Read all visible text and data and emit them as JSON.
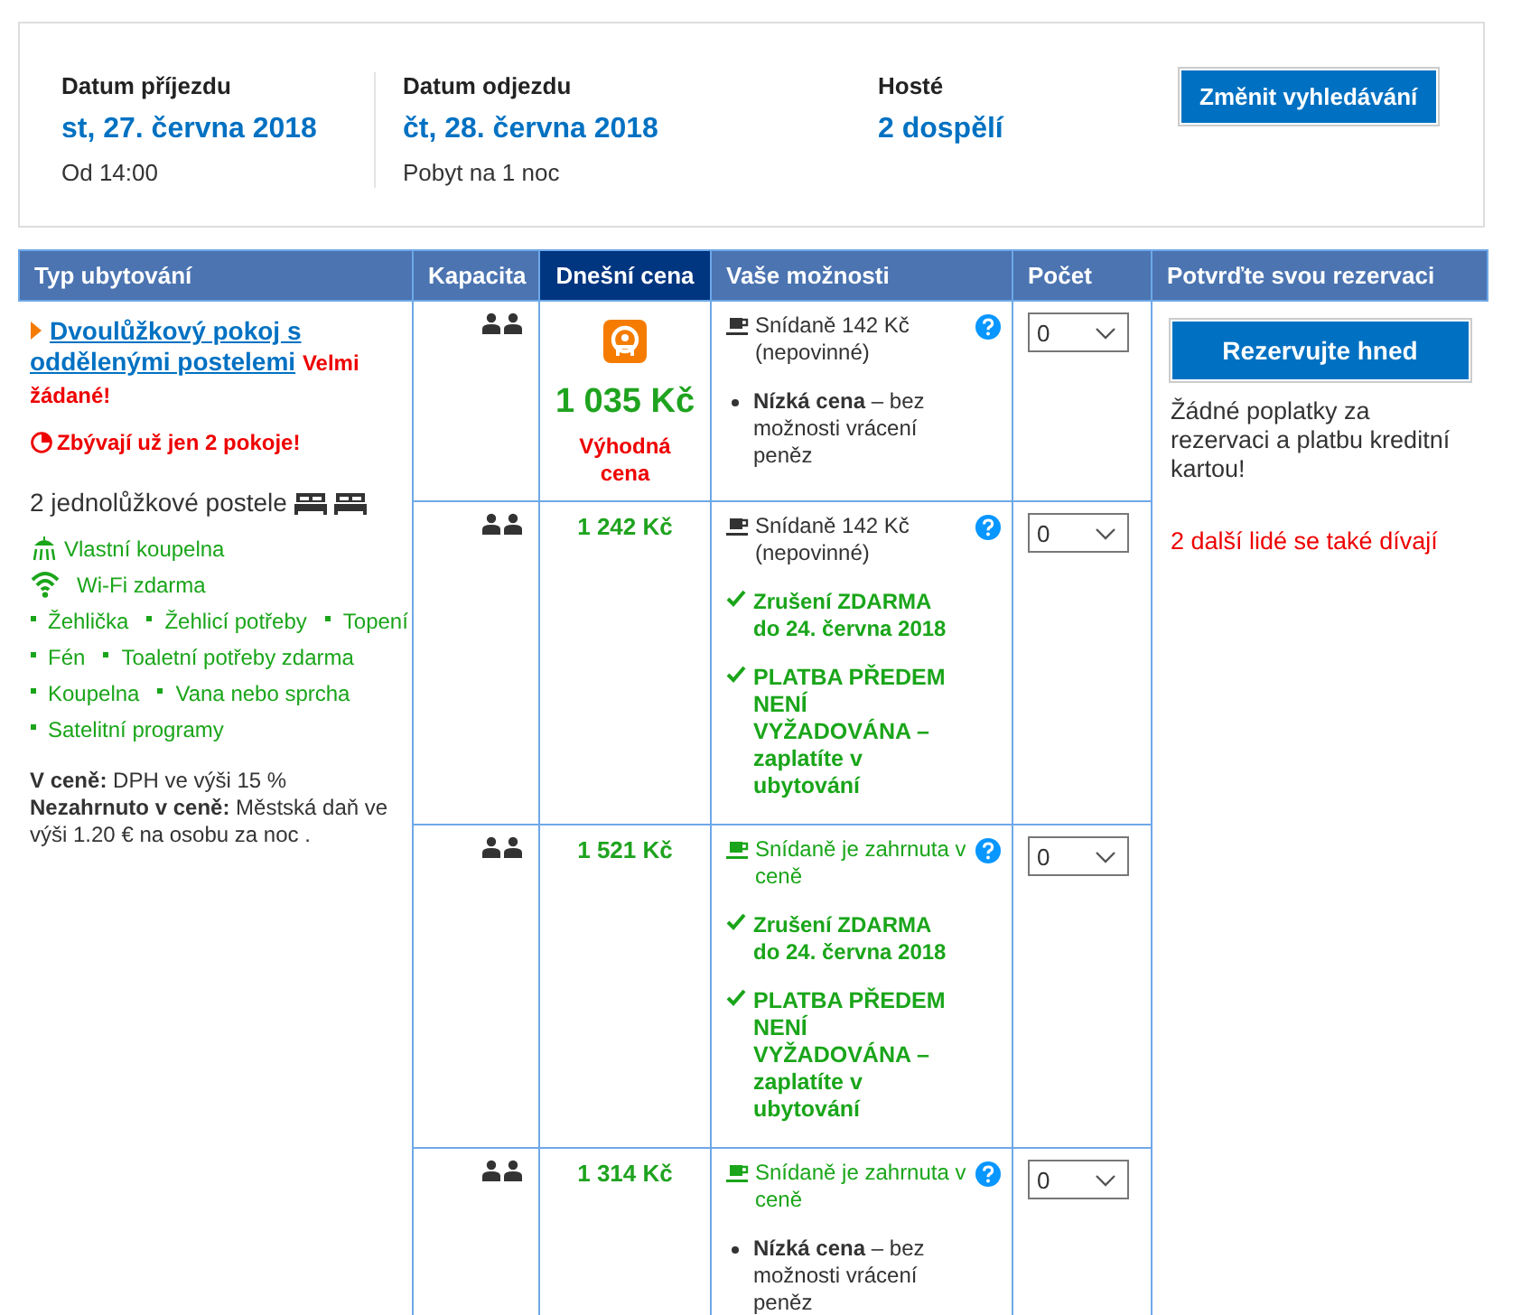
{
  "search": {
    "fields": [
      {
        "label": "Datum příjezdu",
        "value": "st, 27. června 2018",
        "note": "Od 14:00"
      },
      {
        "label": "Datum odjezdu",
        "value": "čt, 28. června 2018",
        "note": "Pobyt na 1 noc"
      },
      {
        "label": "Hosté",
        "value": "2 dospělí"
      }
    ],
    "button": "Změnit vyhledávání"
  },
  "table": {
    "columns": [
      {
        "label": "Typ ubytování",
        "selected": false
      },
      {
        "label": "Kapacita",
        "selected": false
      },
      {
        "label": "Dnešní cena",
        "selected": true
      },
      {
        "label": "Vaše možnosti",
        "selected": false
      },
      {
        "label": "Počet",
        "selected": false
      },
      {
        "label": "Potvrďte svou rezervaci",
        "selected": false
      }
    ],
    "room": {
      "name": "Dvoulůžkový pokoj s oddělenými postelemi",
      "badge": "Velmi žádané!",
      "scarcity": "Zbývají už jen 2 pokoje!",
      "beds": "2 jednolůžkové postele",
      "facilities": [
        {
          "kind": "shower",
          "label": "Vlastní koupelna"
        },
        {
          "kind": "wifi",
          "label": "Wi-Fi zdarma"
        },
        {
          "kind": "bullets",
          "items": [
            "Žehlička",
            "Žehlicí potřeby",
            "Topení"
          ]
        },
        {
          "kind": "bullets",
          "items": [
            "Fén",
            "Toaletní potřeby zdarma"
          ]
        },
        {
          "kind": "bullets",
          "items": [
            "Koupelna",
            "Vana nebo sprcha"
          ]
        },
        {
          "kind": "bullets",
          "items": [
            "Satelitní programy"
          ]
        }
      ],
      "notes": [
        "**V ceně:** DPH ve výši 15 %",
        "**Nezahrnuto v ceně:** Městská daň ve výši 1.20 € na osobu za noc ."
      ]
    },
    "offers": [
      {
        "deal": true,
        "price": "1 035 Kč",
        "deal_label": "Výhodná cena",
        "meal": {
          "kind": "optional",
          "text": "Snídaně 142 Kč (nepovinné)"
        },
        "conditions": [
          {
            "kind": "bullet",
            "text": "**Nízká cena** – bez možnosti vrácení peněz"
          }
        ],
        "count": "0"
      },
      {
        "deal": false,
        "price": "1 242 Kč",
        "meal": {
          "kind": "optional",
          "text": "Snídaně 142 Kč (nepovinné)"
        },
        "conditions": [
          {
            "kind": "check",
            "text": "Zrušení ZDARMA do 24. června 2018"
          },
          {
            "kind": "check-strong",
            "text": "PLATBA PŘEDEM NENÍ VYŽADOVÁNA – zaplatíte v ubytování"
          }
        ],
        "count": "0"
      },
      {
        "deal": false,
        "price": "1 521 Kč",
        "meal": {
          "kind": "included",
          "text": "Snídaně je zahrnuta v ceně"
        },
        "conditions": [
          {
            "kind": "check",
            "text": "Zrušení ZDARMA do 24. června 2018"
          },
          {
            "kind": "check-strong",
            "text": "PLATBA PŘEDEM NENÍ VYŽADOVÁNA – zaplatíte v ubytování"
          }
        ],
        "count": "0"
      },
      {
        "deal": false,
        "price": "1 314 Kč",
        "meal": {
          "kind": "included",
          "text": "Snídaně je zahrnuta v ceně"
        },
        "conditions": [
          {
            "kind": "bullet",
            "text": "**Nízká cena** – bez možnosti vrácení peněz"
          }
        ],
        "count": "0"
      }
    ],
    "confirm": {
      "button": "Rezervujte hned",
      "note": "Žádné poplatky za rezervaci a platbu kreditní kartou!",
      "watchers": "2 další lidé se také dívají"
    }
  }
}
